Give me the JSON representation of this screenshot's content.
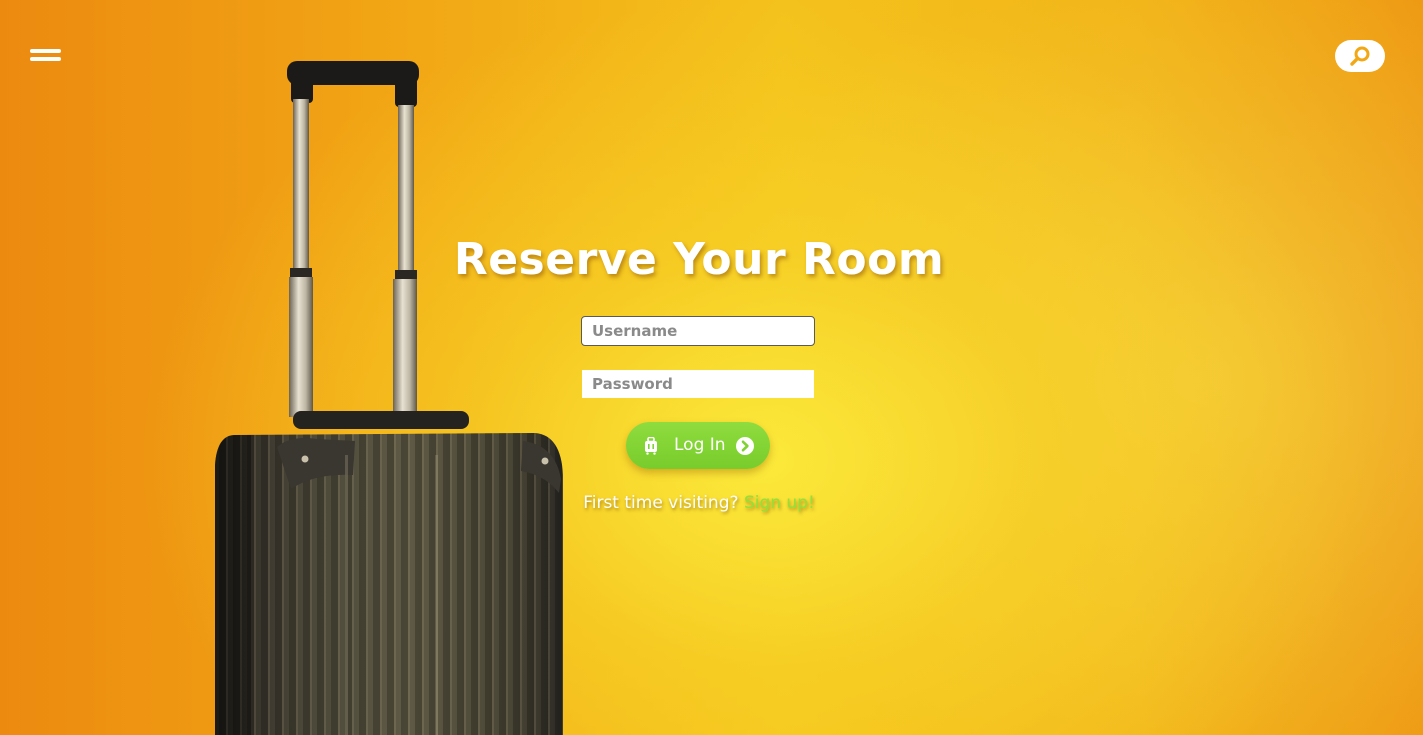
{
  "header": {
    "menu_icon": "hamburger-icon",
    "search_icon": "search-icon"
  },
  "hero": {
    "image": "suitcase-illustration"
  },
  "login": {
    "title": "Reserve Your Room",
    "username_placeholder": "Username",
    "username_value": "",
    "password_placeholder": "Password",
    "password_value": "",
    "login_label": "Log In",
    "login_icon_left": "luggage-icon",
    "login_icon_right": "chevron-circle-right-icon",
    "signup_prompt": "First time visiting?",
    "signup_link": "Sign up!"
  },
  "colors": {
    "background_primary": "#f2a815",
    "background_glow": "#fcec3c",
    "button": "#80d234",
    "link": "#8ee23a",
    "text": "#ffffff"
  }
}
